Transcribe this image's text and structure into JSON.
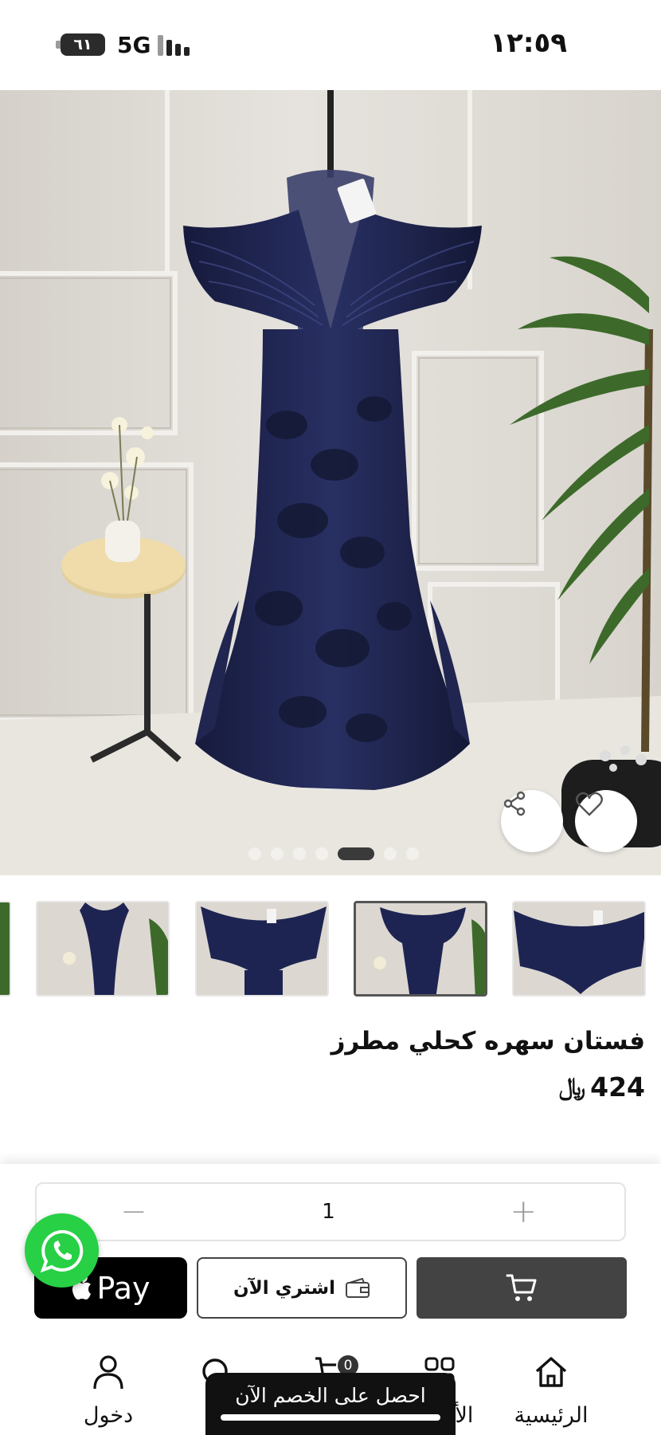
{
  "status_bar": {
    "time": "١٢:٥٩",
    "battery": "٦١",
    "network": "5G"
  },
  "product": {
    "title": "فستان سهره كحلي مطرز",
    "price": "424",
    "currency_symbol": "﷼",
    "image_count": 7,
    "active_image_index": 4
  },
  "quantity": {
    "value": "1",
    "minus": "−",
    "plus": "+"
  },
  "actions": {
    "apple_pay_label": "Pay",
    "buy_now_label": "اشتري الآن"
  },
  "nav": {
    "items": [
      {
        "label": "الرئيسية",
        "icon": "home-icon"
      },
      {
        "label": "الأقسام",
        "icon": "grid-icon"
      },
      {
        "label": "",
        "icon": "cart-icon",
        "badge": "0"
      },
      {
        "label": "",
        "icon": "search-icon"
      },
      {
        "label": "دخول",
        "icon": "user-icon"
      }
    ]
  },
  "promo_banner": "احصل على الخصم الآن",
  "colors": {
    "dress": "#1e2452",
    "accent_dark": "#434343",
    "whatsapp": "#27d045"
  }
}
